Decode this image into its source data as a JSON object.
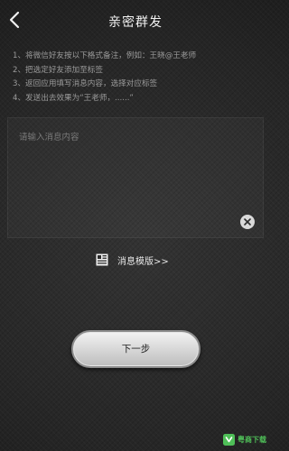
{
  "header": {
    "title": "亲密群发",
    "back_icon": "chevron-left-icon"
  },
  "instructions": [
    "1、将微信好友按以下格式备注，例如：王晓@王老师",
    "2、把选定好友添加至标签",
    "3、返回应用填写消息内容，选择对应标签",
    "4、发送出去效果为“王老师，......”"
  ],
  "message_input": {
    "value": "",
    "placeholder": "请输入消息内容",
    "clear_icon": "clear-icon"
  },
  "template_link": {
    "icon": "template-icon",
    "label": "消息模版>>"
  },
  "next_button": {
    "label": "下一步"
  },
  "watermark": {
    "icon": "logo-icon",
    "text": "粤商下载"
  },
  "colors": {
    "background": "#2b2b2b",
    "title_text": "#f2f2f2",
    "instruction_text": "#9a9a9a",
    "button_face": "#e0e0e0",
    "watermark_green": "#4fbf58"
  }
}
